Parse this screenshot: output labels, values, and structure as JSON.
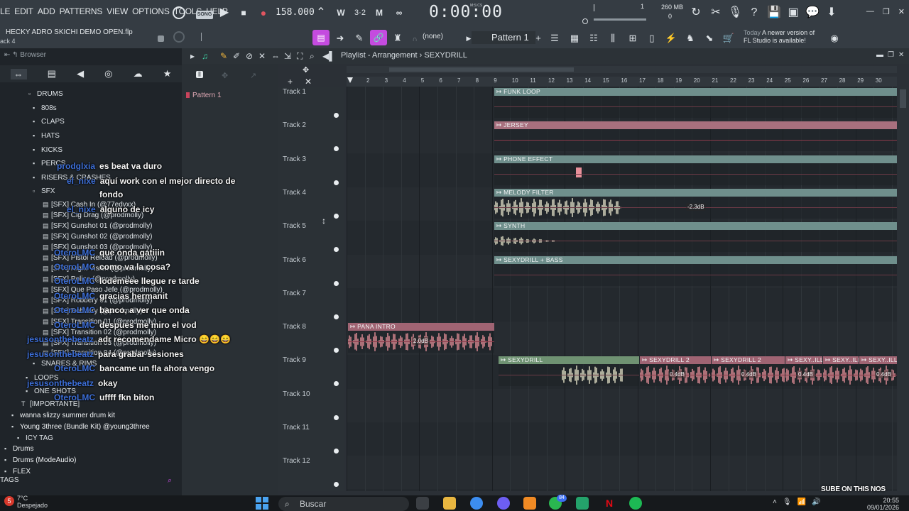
{
  "menu": [
    "LE",
    "EDIT",
    "ADD",
    "PATTERNS",
    "VIEW",
    "OPTIONS",
    "TOOLS",
    "HELP"
  ],
  "transport": {
    "song_badge": "SONG",
    "tempo": "158.000",
    "time": "0:00:00",
    "time_unit": "M:S:CS"
  },
  "cpu": {
    "memory": "260 MB",
    "polyphony": "0",
    "cpu_num": "1"
  },
  "project": {
    "file": "HECKY ADRO SKICHI DEMO OPEN.flp",
    "hint": "ack 4"
  },
  "toolbar": {
    "none_label": "(none)",
    "pattern": "Pattern 1",
    "news_prefix": "Today",
    "news_line1": "A newer version of",
    "news_line2": "FL Studio is available!"
  },
  "browser": {
    "title": "Browser",
    "items": [
      {
        "label": "DRUMS",
        "icon": "folder-open"
      },
      {
        "label": "808s",
        "icon": "folder"
      },
      {
        "label": "CLAPS",
        "icon": "folder"
      },
      {
        "label": "HATS",
        "icon": "folder"
      },
      {
        "label": "KICKS",
        "icon": "folder"
      },
      {
        "label": "PERCS",
        "icon": "folder"
      },
      {
        "label": "RISERS & CRASHES",
        "icon": "folder"
      },
      {
        "label": "SFX",
        "icon": "folder-open"
      },
      {
        "label": "[SFX] Cash In (@77edvxx)"
      },
      {
        "label": "[SFX] Cig Drag (@prodmolly)"
      },
      {
        "label": "[SFX] Gunshot 01 (@prodmolly)"
      },
      {
        "label": "[SFX] Gunshot 02 (@prodmolly)"
      },
      {
        "label": "[SFX] Gunshot 03 (@prodmolly)"
      },
      {
        "label": "[SFX] Pistol Reload (@prodmolly)"
      },
      {
        "label": "[SFX] Night Vision (@prodmolly)"
      },
      {
        "label": "[SFX] Police (@prodmolly)"
      },
      {
        "label": "[SFX] Que Paso Jefe (@prodmolly)"
      },
      {
        "label": "[SFX] Robbery 01 (@prodmolly)"
      },
      {
        "label": "[SFX] Robbery (@prodmolly)"
      },
      {
        "label": "[SFX] Transition 01 (@prodmolly)"
      },
      {
        "label": "[SFX] Transition 02 (@prodmolly)"
      },
      {
        "label": "[SFX] Transition 03 (@prodmolly)"
      },
      {
        "label": "[SFX] Transition 04 (@prodmolly)"
      },
      {
        "label": "SNARES & RIMS",
        "icon": "folder"
      },
      {
        "label": "LOOPS",
        "icon": "folder"
      },
      {
        "label": "ONE SHOTS",
        "icon": "folder"
      },
      {
        "label": "[IMPORTANTE]",
        "icon": "text"
      },
      {
        "label": "wanna slizzy summer drum kit",
        "icon": "folder"
      },
      {
        "label": "Young 3three (Bundle Kit) @young3three",
        "icon": "folder"
      },
      {
        "label": "ICY TAG",
        "icon": "folder"
      },
      {
        "label": "Drums",
        "icon": "folder"
      },
      {
        "label": "Drums (ModeAudio)",
        "icon": "folder"
      },
      {
        "label": "FLEX",
        "icon": "folder"
      }
    ],
    "tags": "TAGS"
  },
  "chat": [
    {
      "user": "prodglxia",
      "msg": "es beat va duro"
    },
    {
      "user": "el_nixe",
      "msg": "aquí work con el mejor directo de"
    },
    {
      "user": "",
      "msg": "fondo"
    },
    {
      "user": "el_nixe",
      "msg": "alguno de icy"
    },
    {
      "user": "OteroLMC",
      "msg": "que onda gatiiin"
    },
    {
      "user": "OteroLMC",
      "msg": "como va la cosa?"
    },
    {
      "user": "OteroLMC",
      "msg": "lodemeee llegue re tarde"
    },
    {
      "user": "OteroLMC",
      "msg": "gracias hermanit"
    },
    {
      "user": "OteroLMC",
      "msg": "banco, a ver que onda"
    },
    {
      "user": "OteroLMC",
      "msg": "despues me miro el vod"
    },
    {
      "user": "jesusonthebeatz",
      "msg": "adr recomendame Micro 😄😄😄"
    },
    {
      "user": "jesusonthebeatz",
      "msg": "para grabar sesiones"
    },
    {
      "user": "OteroLMC",
      "msg": "bancame un fla ahora vengo"
    },
    {
      "user": "jesusonthebeatz",
      "msg": "okay"
    },
    {
      "user": "OteroLMC",
      "msg": "uffff fkn biton"
    }
  ],
  "patterns": [
    "Pattern 1"
  ],
  "playlist": {
    "title": "Playlist - Arrangement",
    "arrangement": "SEXYDRILL",
    "ruler": [
      "2",
      "3",
      "4",
      "5",
      "6",
      "7",
      "8",
      "9",
      "10",
      "11",
      "12",
      "13",
      "14",
      "15",
      "16",
      "17",
      "18",
      "19",
      "20",
      "21",
      "22",
      "23",
      "24",
      "25",
      "26",
      "27",
      "28",
      "29",
      "30"
    ]
  },
  "tracks": [
    "Track 1",
    "Track 2",
    "Track 3",
    "Track 4",
    "Track 5",
    "Track 6",
    "Track 7",
    "Track 8",
    "Track 9",
    "Track 10",
    "Track 11",
    "Track 12"
  ],
  "clips": [
    {
      "name": "FUNK LOOP",
      "track": 1,
      "color": "#6f8f8c"
    },
    {
      "name": "JERSEY",
      "track": 2,
      "color": "#a8707e"
    },
    {
      "name": "PHONE EFFECT",
      "track": 3,
      "color": "#6f8f8c"
    },
    {
      "name": "MELODY FILTER",
      "track": 4,
      "color": "#6f8f8c",
      "badge": "-2.3dB"
    },
    {
      "name": "SYNTH",
      "track": 5,
      "color": "#6f8f8c"
    },
    {
      "name": "SEXYDRILL + BASS",
      "track": 6,
      "color": "#6f8f8c"
    },
    {
      "name": "PANA INTRO",
      "track": 8,
      "color": "#a06473",
      "badge": "2.0dB"
    },
    {
      "name": "SEXYDRILL",
      "track": 9,
      "color": "#6f9272"
    },
    {
      "name": "SEXYDRILL 2",
      "track": 9,
      "color": "#a06473",
      "badge": "0.4dB"
    },
    {
      "name": "SEXYDRILL 2",
      "track": 9,
      "color": "#a06473",
      "badge": "0.4dB"
    },
    {
      "name": "SEXY..ILL 2",
      "track": 9,
      "color": "#a06473",
      "badge": "0.4dB"
    },
    {
      "name": "SEXY..ILL",
      "track": 9,
      "color": "#a06473"
    },
    {
      "name": "SEXY..ILL",
      "track": 9,
      "color": "#a06473",
      "badge": "0.4dB"
    }
  ],
  "taskbar": {
    "weather_temp": "7°C",
    "weather_desc": "Despejado",
    "search": "Buscar",
    "time": "20:55",
    "date": "09/01/2026",
    "notif_count": "5",
    "whatsapp_count": "84"
  },
  "watermark": "SUBE ON THIS NOS"
}
